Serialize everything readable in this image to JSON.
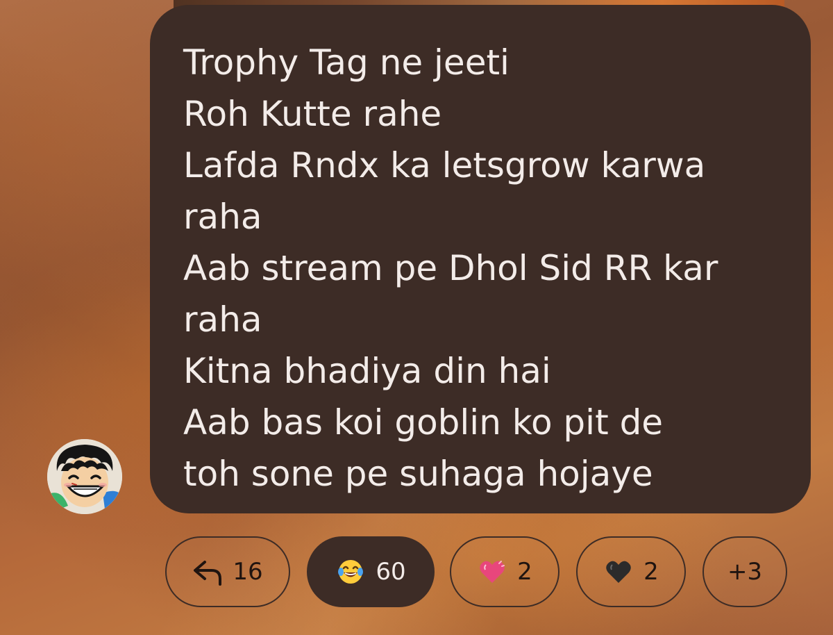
{
  "message": {
    "lines": [
      "Trophy Tag ne jeeti",
      "Roh Kutte rahe",
      "Lafda Rndx ka letsgrow karwa",
      "raha",
      "Aab stream pe Dhol Sid RR kar",
      "raha",
      "Kitna bhadiya din hai",
      "Aab bas koi goblin ko pit de",
      "toh sone pe suhaga hojaye"
    ]
  },
  "reactions": {
    "reply": {
      "icon": "reply-arrow-icon",
      "count": "16"
    },
    "laugh": {
      "icon": "laughing-tears-emoji",
      "count": "60"
    },
    "heart": {
      "icon": "pink-heart-emoji",
      "count": "2"
    },
    "black_heart": {
      "icon": "black-heart-emoji",
      "count": "2"
    },
    "more": {
      "label": "+3"
    }
  },
  "colors": {
    "bubble": "#3d2c26",
    "text": "#f3ece9",
    "pink_heart": "#e8467c",
    "black_heart": "#2b2b2b"
  }
}
